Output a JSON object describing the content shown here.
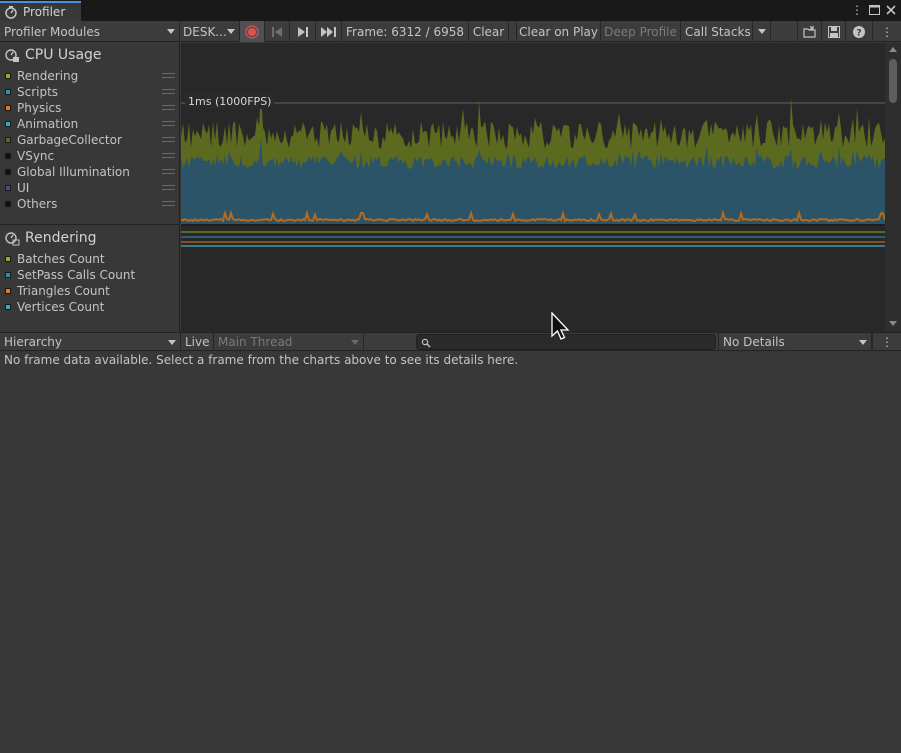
{
  "window": {
    "tab_label": "Profiler",
    "more_icon": "kebab-icon",
    "maximize_icon": "maximize-icon",
    "close_icon": "close-icon"
  },
  "toolbar": {
    "modules_dropdown": "Profiler Modules",
    "target_dropdown": "DESK...",
    "frame_label": "Frame: 6312 / 6958",
    "clear": "Clear",
    "clear_on_play": "Clear on Play",
    "deep_profile": "Deep Profile",
    "call_stacks": "Call Stacks"
  },
  "cpu_module": {
    "title": "CPU Usage",
    "legend": [
      {
        "label": "Rendering",
        "color": "#8fb023"
      },
      {
        "label": "Scripts",
        "color": "#2e8fb6"
      },
      {
        "label": "Physics",
        "color": "#d97e18"
      },
      {
        "label": "Animation",
        "color": "#3aaeb5"
      },
      {
        "label": "GarbageCollector",
        "color": "#5a6d22"
      },
      {
        "label": "VSync",
        "color": "#111111"
      },
      {
        "label": "Global Illumination",
        "color": "#111111"
      },
      {
        "label": "UI",
        "color": "#4d4a8a"
      },
      {
        "label": "Others",
        "color": "#111111"
      }
    ],
    "threshold_label": "1ms (1000FPS)"
  },
  "rendering_module": {
    "title": "Rendering",
    "legend": [
      {
        "label": "Batches Count",
        "color": "#8fb023"
      },
      {
        "label": "SetPass Calls Count",
        "color": "#2e8fb6"
      },
      {
        "label": "Triangles Count",
        "color": "#d97e18"
      },
      {
        "label": "Vertices Count",
        "color": "#3aaeb5"
      }
    ]
  },
  "details": {
    "view_dropdown": "Hierarchy",
    "live": "Live",
    "thread_dropdown": "Main Thread",
    "search_placeholder": "",
    "details_dropdown": "No Details",
    "empty_message": "No frame data available. Select a frame from the charts above to see its details here."
  }
}
